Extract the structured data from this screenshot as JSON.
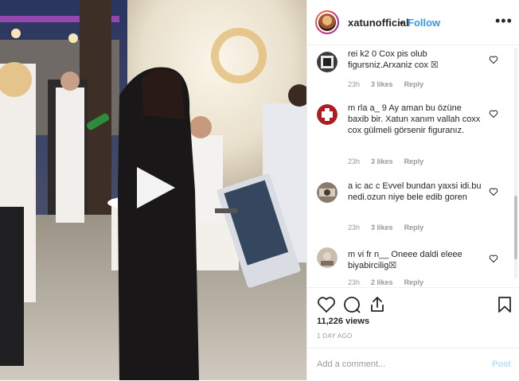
{
  "header": {
    "username": "xatunofficial",
    "separator": "•",
    "follow_label": "Follow",
    "more_icon": "more-options-icon"
  },
  "comments": [
    {
      "text": "rеі k2  0 Cox pis olub figursniz.Arxaniz cox ☒",
      "time": "23h",
      "likes": "3 likes",
      "reply": "Reply"
    },
    {
      "text": "m rla  a_ 9 Ay aman bu özüne baxib bir. Xatun xanım vallah coxx cox gülmeli görsenir figuranız.",
      "time": "23h",
      "likes": "3 likes",
      "reply": "Reply"
    },
    {
      "text": "a  ic  ac  c Evvel bundan yaxsi idi.bu nedi.ozun niye bele edib goren",
      "time": "23h",
      "likes": "3 likes",
      "reply": "Reply"
    },
    {
      "text": "m  vi   fr   n__ Oneee daldi eleee biyabircilig☒",
      "time": "23h",
      "likes": "2 likes",
      "reply": "Reply"
    }
  ],
  "actions": {
    "like_icon": "heart-icon",
    "comment_icon": "comment-icon",
    "share_icon": "share-icon",
    "save_icon": "bookmark-icon"
  },
  "stats": {
    "views": "11,226 views",
    "time_ago": "1 DAY AGO"
  },
  "add_comment": {
    "placeholder": "Add a comment...",
    "post_label": "Post"
  },
  "colors": {
    "accent": "#3897f0",
    "post_disabled": "#b2dffc",
    "muted": "#999999"
  }
}
